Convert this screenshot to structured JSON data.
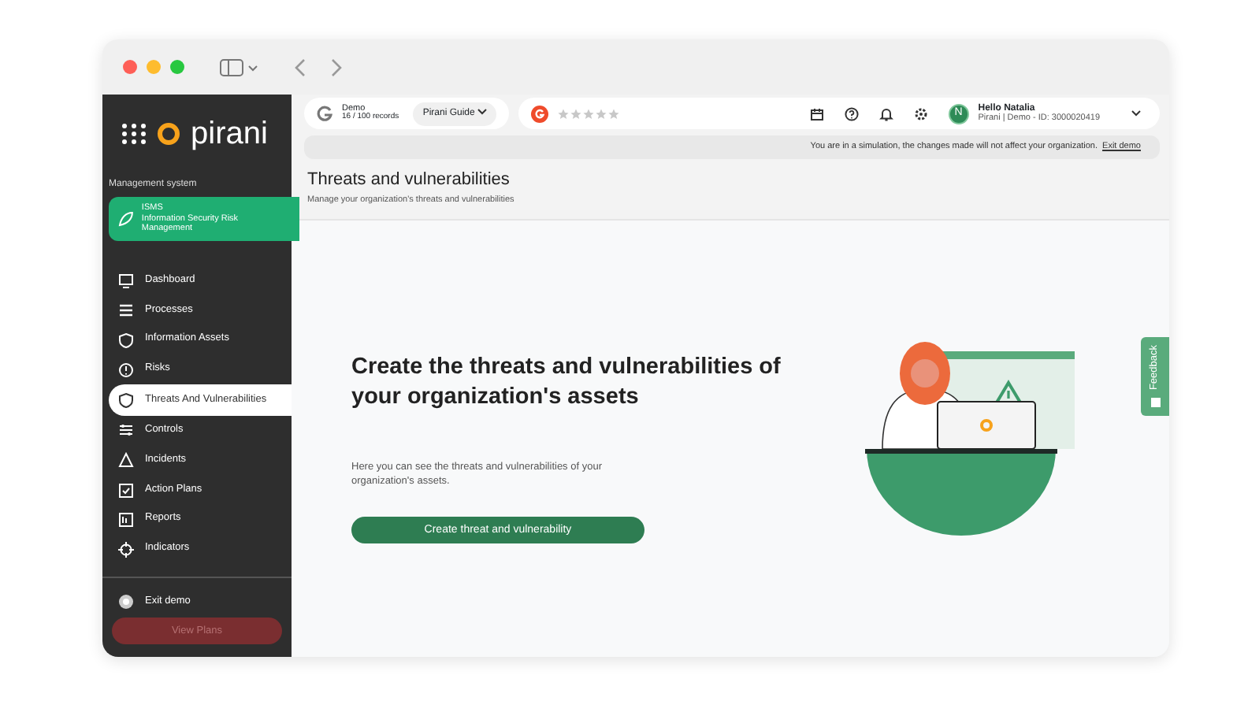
{
  "header": {
    "demo_label": "Demo",
    "records": "16 / 100 records",
    "guide": "Pirani Guide",
    "rating": {
      "stars": 0
    },
    "user_greeting": "Hello Natalia",
    "user_detail": "Pirani | Demo - ID: 3000020419",
    "avatar_letter": "N"
  },
  "banner": {
    "text": "You are in a simulation, the changes made will not affect your organization.",
    "link": "Exit demo"
  },
  "sidebar": {
    "logo": "pirani",
    "section_label": "Management system",
    "system": {
      "code": "ISMS",
      "name": "Information Security Risk Management"
    },
    "items": [
      {
        "label": "Dashboard",
        "selected": false
      },
      {
        "label": "Processes",
        "selected": false
      },
      {
        "label": "Information Assets",
        "selected": false
      },
      {
        "label": "Risks",
        "selected": false
      },
      {
        "label": "Threats And Vulnerabilities",
        "selected": true
      },
      {
        "label": "Controls",
        "selected": false
      },
      {
        "label": "Incidents",
        "selected": false
      },
      {
        "label": "Action Plans",
        "selected": false
      },
      {
        "label": "Reports",
        "selected": false
      },
      {
        "label": "Indicators",
        "selected": false
      }
    ],
    "exit": "Exit demo",
    "plans_button": "View Plans"
  },
  "page": {
    "title": "Threats and vulnerabilities",
    "subtitle": "Manage your organization's threats and vulnerabilities",
    "empty_state": {
      "heading": "Create the threats and vulnerabilities of your organization's assets",
      "text": "Here you can see the threats and vulnerabilities of your organization's assets.",
      "button": "Create threat and vulnerability"
    }
  },
  "feedback_tab": "Feedback"
}
